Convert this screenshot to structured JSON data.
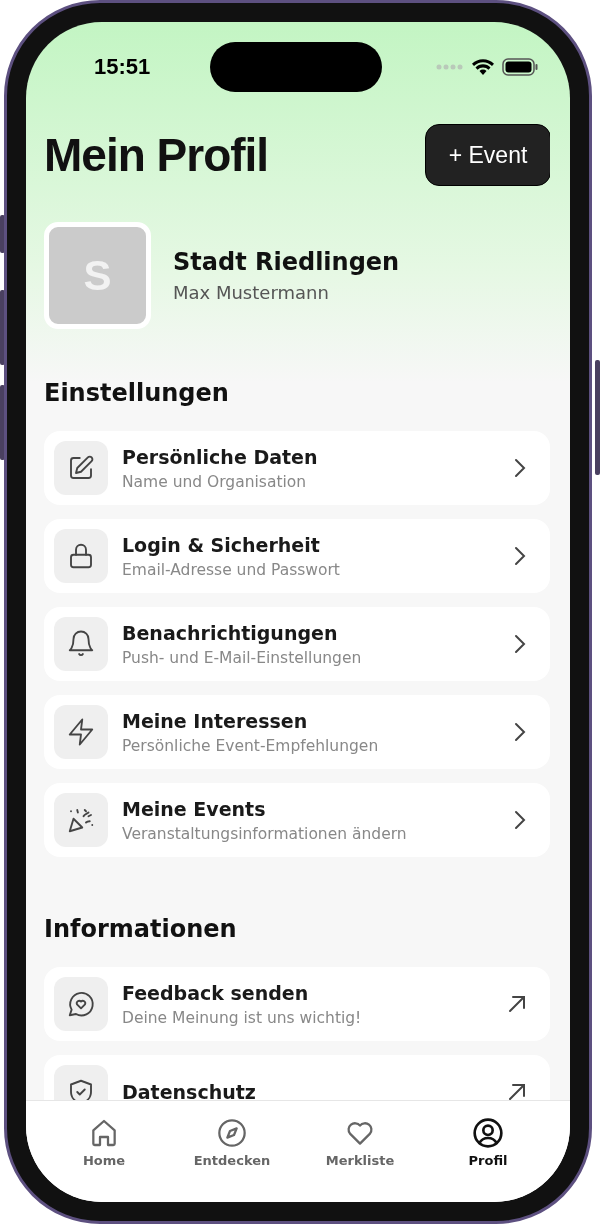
{
  "status_bar": {
    "time": "15:51"
  },
  "header": {
    "title": "Mein Profil",
    "action_button": "+ Event"
  },
  "profile": {
    "avatar_letter": "S",
    "name": "Stadt Riedlingen",
    "subtitle": "Max Mustermann"
  },
  "sections": [
    {
      "title": "Einstellungen",
      "items": [
        {
          "title": "Persönliche Daten",
          "subtitle": "Name und Organisation",
          "kind": "internal"
        },
        {
          "title": "Login & Sicherheit",
          "subtitle": "Email-Adresse und Passwort",
          "kind": "internal"
        },
        {
          "title": "Benachrichtigungen",
          "subtitle": "Push- und E-Mail-Einstellungen",
          "kind": "internal"
        },
        {
          "title": "Meine Interessen",
          "subtitle": "Persönliche Event-Empfehlungen",
          "kind": "internal"
        },
        {
          "title": "Meine Events",
          "subtitle": "Veranstaltungsinformationen ändern",
          "kind": "internal"
        }
      ]
    },
    {
      "title": "Informationen",
      "items": [
        {
          "title": "Feedback senden",
          "subtitle": "Deine Meinung ist uns wichtig!",
          "kind": "external"
        },
        {
          "title": "Datenschutz",
          "kind": "external"
        }
      ]
    }
  ],
  "tab_bar": [
    {
      "label": "Home",
      "selected": false
    },
    {
      "label": "Entdecken",
      "selected": false
    },
    {
      "label": "Merkliste",
      "selected": false
    },
    {
      "label": "Profil",
      "selected": true
    }
  ]
}
